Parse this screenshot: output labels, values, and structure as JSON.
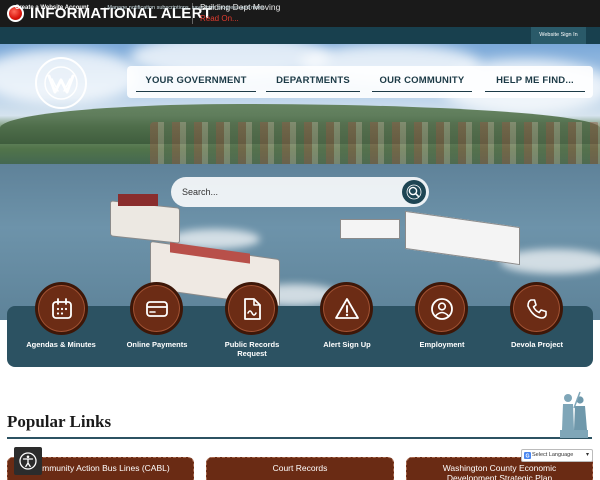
{
  "alert": {
    "title": "INFORMATIONAL ALERT",
    "message": "Building Dept Moving",
    "read_on": "Read On..."
  },
  "account_bar": {
    "create_label": "Create a Website Account",
    "create_desc": "- Manage notification subscriptions, save form progress and more.",
    "sign_in": "Website Sign In"
  },
  "nav": {
    "items": [
      {
        "label": "YOUR GOVERNMENT"
      },
      {
        "label": "DEPARTMENTS"
      },
      {
        "label": "OUR COMMUNITY"
      },
      {
        "label": "HELP ME FIND..."
      }
    ]
  },
  "search": {
    "placeholder": "Search..."
  },
  "quick_links": [
    {
      "label": "Agendas & Minutes",
      "icon": "calendar-icon"
    },
    {
      "label": "Online Payments",
      "icon": "credit-card-icon"
    },
    {
      "label": "Public Records Request",
      "icon": "document-icon"
    },
    {
      "label": "Alert Sign Up",
      "icon": "warning-icon"
    },
    {
      "label": "Employment",
      "icon": "person-icon"
    },
    {
      "label": "Devola Project",
      "icon": "phone-icon"
    }
  ],
  "popular": {
    "title": "Popular Links",
    "items": [
      {
        "label": "Community Action Bus Lines (CABL)"
      },
      {
        "label": "Court Records"
      },
      {
        "label": "Washington County Economic Development Strategic Plan"
      }
    ]
  },
  "language": {
    "label": "Select Language"
  },
  "colors": {
    "alert_bg": "#1a1a1a",
    "account_bar": "#18404e",
    "panel": "#2c5262",
    "button_brown": "#6a2b14"
  }
}
